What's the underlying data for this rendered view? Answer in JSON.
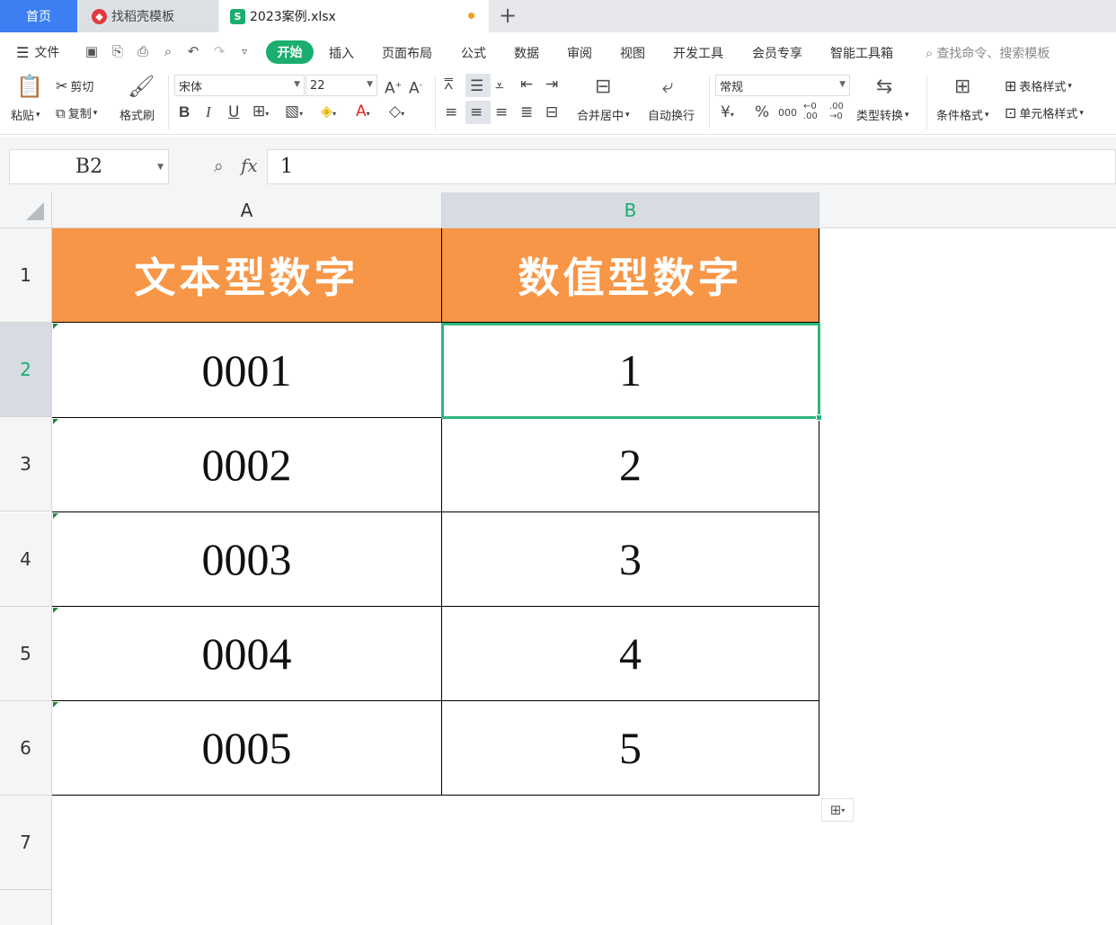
{
  "tabs": {
    "home": "首页",
    "template": "找稻壳模板",
    "document": "2023案例.xlsx"
  },
  "menu": {
    "file": "文件",
    "items": [
      "开始",
      "插入",
      "页面布局",
      "公式",
      "数据",
      "审阅",
      "视图",
      "开发工具",
      "会员专享",
      "智能工具箱"
    ],
    "search_placeholder": "查找命令、搜索模板"
  },
  "ribbon": {
    "paste": "粘贴",
    "cut": "剪切",
    "copy": "复制",
    "format_painter": "格式刷",
    "font_name": "宋体",
    "font_size": "22",
    "merge_center": "合并居中",
    "wrap_text": "自动换行",
    "number_format": "常规",
    "type_convert": "类型转换",
    "conditional_format": "条件格式",
    "table_style": "表格样式",
    "cell_style": "单元格样式",
    "currency_symbol": "¥",
    "percent_symbol": "%",
    "thousands_symbol": "000",
    "inc_decimal": "←0 .00",
    "dec_decimal": ".00 →0"
  },
  "formula_bar": {
    "name_box": "B2",
    "fx": "fx",
    "content": "1"
  },
  "sheet": {
    "columns": [
      "A",
      "B"
    ],
    "rows": [
      "1",
      "2",
      "3",
      "4",
      "5",
      "6",
      "7"
    ],
    "header": [
      "文本型数字",
      "数值型数字"
    ],
    "data": [
      [
        "0001",
        "1"
      ],
      [
        "0002",
        "2"
      ],
      [
        "0003",
        "3"
      ],
      [
        "0004",
        "4"
      ],
      [
        "0005",
        "5"
      ]
    ]
  },
  "colors": {
    "header_fill": "#f79646",
    "accent": "#1aae6f",
    "selection": "#2db67b"
  }
}
